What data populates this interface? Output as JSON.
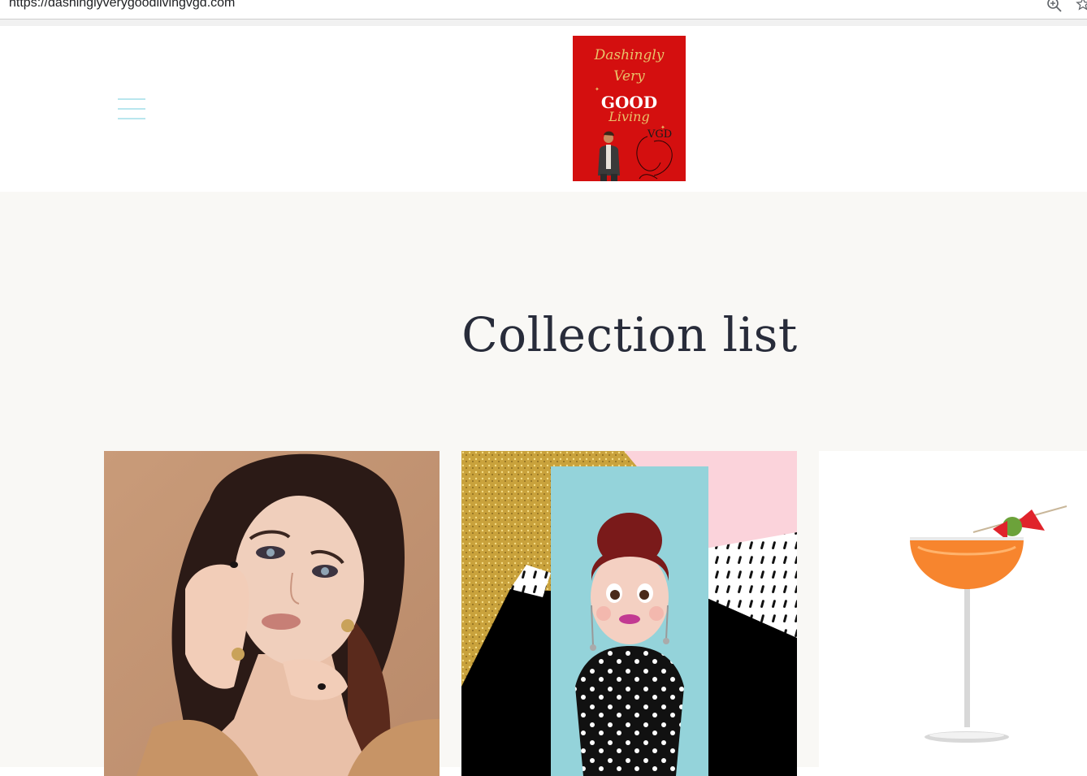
{
  "browser": {
    "url": "https://dashinglyverygoodlivingvgd.com",
    "icons": [
      "zoom-icon",
      "star-icon"
    ]
  },
  "header": {
    "menu_icon": "hamburger-menu-icon",
    "logo": {
      "line1": "Dashingly",
      "line2": "Very",
      "line3": "GOOD",
      "line4": "Living",
      "line5": "VGD",
      "background_color": "#d40f0f"
    }
  },
  "main": {
    "title": "Collection list",
    "collections": [
      {
        "image": "woman-portrait-makeup"
      },
      {
        "image": "avatar-girl-polka-dot"
      },
      {
        "image": "orange-cocktail-glass"
      }
    ]
  },
  "colors": {
    "menu_icon": "#b9e6ee",
    "main_background": "#f9f8f5",
    "title_text": "#282c3a"
  }
}
